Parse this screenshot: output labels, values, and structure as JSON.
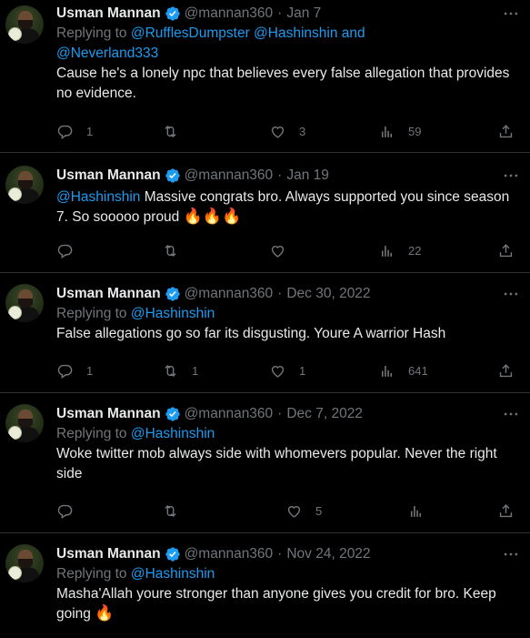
{
  "tweets": [
    {
      "name": "Usman Mannan",
      "handle": "@mannan360",
      "date": "Jan 7",
      "replying_prefix": "Replying to",
      "replying_line1": "@RufflesDumpster @Hashinshin and",
      "replying_line2": "@Neverland333",
      "text": "Cause he's a lonely npc that believes every false allegation that provides no evidence.",
      "replies": "1",
      "retweets": "",
      "likes": "3",
      "views": "59"
    },
    {
      "name": "Usman Mannan",
      "handle": "@mannan360",
      "date": "Jan 19",
      "mention": "@Hashinshin",
      "text": " Massive congrats bro. Always supported you since season 7. So sooooo proud ",
      "emoji": "🔥🔥🔥",
      "replies": "",
      "retweets": "",
      "likes": "",
      "views": "22"
    },
    {
      "name": "Usman Mannan",
      "handle": "@mannan360",
      "date": "Dec 30, 2022",
      "replying_prefix": "Replying to",
      "replying_line1": "@Hashinshin",
      "text": "False allegations go so far its disgusting. Youre A warrior Hash",
      "replies": "1",
      "retweets": "1",
      "likes": "1",
      "views": "641"
    },
    {
      "name": "Usman Mannan",
      "handle": "@mannan360",
      "date": "Dec 7, 2022",
      "replying_prefix": "Replying to",
      "replying_line1": "@Hashinshin",
      "text": "Woke twitter mob always side with whomevers popular. Never the right side",
      "replies": "",
      "retweets": "",
      "likes": "5",
      "views": ""
    },
    {
      "name": "Usman Mannan",
      "handle": "@mannan360",
      "date": "Nov 24, 2022",
      "replying_prefix": "Replying to",
      "replying_line1": "@Hashinshin",
      "text": "Masha'Allah youre stronger than anyone gives you credit for bro. Keep going ",
      "emoji": "🔥"
    }
  ],
  "dot": "·",
  "colors": {
    "background": "#000000",
    "text": "#e7e9ea",
    "muted": "#71767b",
    "accent": "#1d9bf0",
    "divider": "#2f3336"
  },
  "icons": [
    "verified-badge-icon",
    "more-icon",
    "reply-icon",
    "retweet-icon",
    "like-icon",
    "views-icon",
    "share-icon"
  ]
}
